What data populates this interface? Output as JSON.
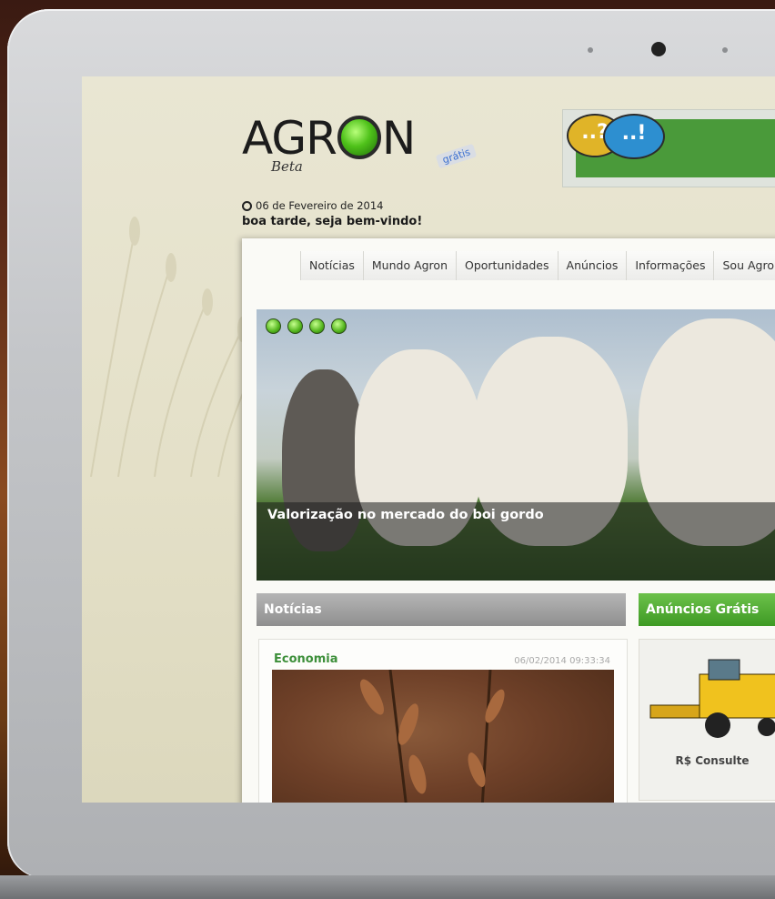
{
  "site": {
    "logo_text_1": "AGR",
    "logo_text_2": "N",
    "beta_label": "Beta",
    "gratis_badge": "grátis",
    "date": "06 de Fevereiro de 2014",
    "greeting": "boa tarde, seja bem-vindo!",
    "banner_bubble_1": "..?",
    "banner_bubble_2": "..!"
  },
  "nav": {
    "items": [
      {
        "label": "Notícias"
      },
      {
        "label": "Mundo Agron"
      },
      {
        "label": "Oportunidades"
      },
      {
        "label": "Anúncios"
      },
      {
        "label": "Informações"
      },
      {
        "label": "Sou Agron"
      }
    ]
  },
  "hero": {
    "caption": "Valorização no mercado do boi gordo",
    "slide_count": 4
  },
  "news": {
    "header": "Notícias",
    "category": "Economia",
    "timestamp": "06/02/2014 09:33:34"
  },
  "ads": {
    "header": "Anúncios Grátis",
    "price": "R$ Consulte"
  },
  "colors": {
    "accent_green": "#3e9a24",
    "category_green": "#3d8f3a",
    "news_header_gray": "#8f8f8f"
  },
  "icons": [
    "clock-icon",
    "slide-dot-icon",
    "chat-bubble-icon"
  ]
}
